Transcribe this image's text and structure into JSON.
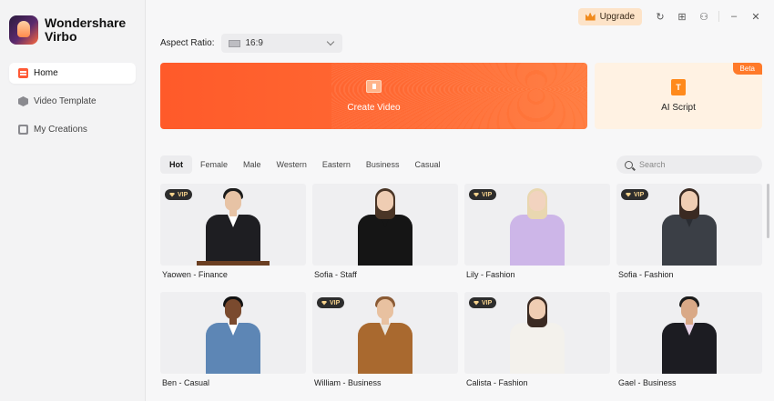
{
  "app": {
    "name_line1": "Wondershare",
    "name_line2": "Virbo"
  },
  "sidebar": {
    "items": [
      {
        "label": "Home",
        "icon": "home-icon",
        "active": true
      },
      {
        "label": "Video Template",
        "icon": "template-icon",
        "active": false
      },
      {
        "label": "My Creations",
        "icon": "creations-icon",
        "active": false
      }
    ]
  },
  "topbar": {
    "upgrade_label": "Upgrade"
  },
  "aspect": {
    "label": "Aspect Ratio:",
    "value": "16:9"
  },
  "actions": {
    "create_video": "Create Video",
    "ai_script": "AI Script",
    "beta": "Beta"
  },
  "tabs": [
    "Hot",
    "Female",
    "Male",
    "Western",
    "Eastern",
    "Business",
    "Casual"
  ],
  "search": {
    "placeholder": "Search"
  },
  "vip_label": "VIP",
  "avatars": [
    {
      "name": "Yaowen - Finance",
      "vip": true
    },
    {
      "name": "Sofia - Staff",
      "vip": false
    },
    {
      "name": "Lily - Fashion",
      "vip": true
    },
    {
      "name": "Sofia - Fashion",
      "vip": true
    },
    {
      "name": "Ben - Casual",
      "vip": false
    },
    {
      "name": "William - Business",
      "vip": true
    },
    {
      "name": "Calista - Fashion",
      "vip": true
    },
    {
      "name": "Gael - Business",
      "vip": false
    }
  ],
  "colors": {
    "accent": "#ff5a2a",
    "vip_bg": "#2d2d2d",
    "vip_text": "#f6d28c"
  }
}
